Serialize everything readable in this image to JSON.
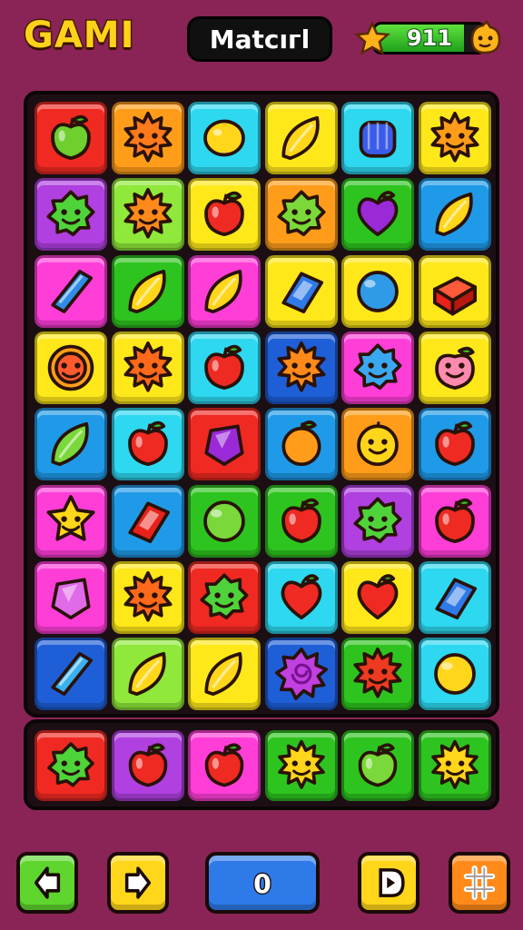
{
  "header": {
    "logo_text": "GAMI",
    "title": "Matcıгl",
    "score": "911",
    "score_fill": 0.82
  },
  "colors": {
    "red": "#f02a22",
    "orange": "#ff9d1a",
    "yellow": "#ffe81a",
    "lime": "#8fe83a",
    "green": "#2ec41f",
    "cyan": "#2ed8f0",
    "blue": "#1f9ae8",
    "navy": "#1e5fd8",
    "purple": "#b040e0",
    "magenta": "#ff3ed8",
    "background": "#8a2457"
  },
  "board": {
    "rows": [
      [
        {
          "bg": "red",
          "icon": "apple-icon",
          "fill": "#6ecf2e"
        },
        {
          "bg": "orange",
          "icon": "sun-face-icon",
          "fill": "#ff7a1a"
        },
        {
          "bg": "cyan",
          "icon": "lemon-icon",
          "fill": "#ffd61a"
        },
        {
          "bg": "yellow",
          "icon": "leaf-icon",
          "fill": "#ffd61a"
        },
        {
          "bg": "cyan",
          "icon": "jar-icon",
          "fill": "#3a5ce8"
        },
        {
          "bg": "yellow",
          "icon": "sun-face-icon",
          "fill": "#ff9d1a"
        }
      ],
      [
        {
          "bg": "purple",
          "icon": "blob-face-icon",
          "fill": "#4fd33a"
        },
        {
          "bg": "lime",
          "icon": "sun-face-icon",
          "fill": "#ff8a1a"
        },
        {
          "bg": "yellow",
          "icon": "apple-icon",
          "fill": "#ee2a22"
        },
        {
          "bg": "orange",
          "icon": "blob-face-icon",
          "fill": "#7ad83a"
        },
        {
          "bg": "green",
          "icon": "heart-fruit-icon",
          "fill": "#9a2ad8"
        },
        {
          "bg": "blue",
          "icon": "leaf-icon",
          "fill": "#ffd61a"
        }
      ],
      [
        {
          "bg": "magenta",
          "icon": "crystal-icon",
          "fill": "#2e8ce8"
        },
        {
          "bg": "green",
          "icon": "leaf-icon",
          "fill": "#ffd61a"
        },
        {
          "bg": "magenta",
          "icon": "leaf-icon",
          "fill": "#ffd61a"
        },
        {
          "bg": "yellow",
          "icon": "candy-box-icon",
          "fill": "#2e7ae8"
        },
        {
          "bg": "yellow",
          "icon": "ball-icon",
          "fill": "#2e9ae8"
        },
        {
          "bg": "yellow",
          "icon": "gift-box-icon",
          "fill": "#e8221a"
        }
      ],
      [
        {
          "bg": "yellow",
          "icon": "lion-face-icon",
          "fill": "#ff5a2e"
        },
        {
          "bg": "yellow",
          "icon": "sun-face-icon",
          "fill": "#ff6a1a"
        },
        {
          "bg": "cyan",
          "icon": "apple-icon",
          "fill": "#ee2a22"
        },
        {
          "bg": "navy",
          "icon": "sun-face-icon",
          "fill": "#ff8a1a"
        },
        {
          "bg": "magenta",
          "icon": "blob-face-icon",
          "fill": "#3aa8f0"
        },
        {
          "bg": "yellow",
          "icon": "peach-face-icon",
          "fill": "#ff8ab0"
        }
      ],
      [
        {
          "bg": "blue",
          "icon": "leaf-icon",
          "fill": "#7ad83a"
        },
        {
          "bg": "cyan",
          "icon": "apple-icon",
          "fill": "#ee2a22"
        },
        {
          "bg": "red",
          "icon": "gem-icon",
          "fill": "#9a2ad8"
        },
        {
          "bg": "blue",
          "icon": "orange-icon",
          "fill": "#ff9d1a"
        },
        {
          "bg": "orange",
          "icon": "smile-face-icon",
          "fill": "#ffd61a"
        },
        {
          "bg": "blue",
          "icon": "apple-icon",
          "fill": "#ee2a22"
        }
      ],
      [
        {
          "bg": "magenta",
          "icon": "star-face-icon",
          "fill": "#ffd61a"
        },
        {
          "bg": "blue",
          "icon": "candy-box-icon",
          "fill": "#e8221a"
        },
        {
          "bg": "green",
          "icon": "ball-icon",
          "fill": "#7ad83a"
        },
        {
          "bg": "green",
          "icon": "apple-icon",
          "fill": "#ee2a22"
        },
        {
          "bg": "purple",
          "icon": "blob-face-icon",
          "fill": "#4fd33a"
        },
        {
          "bg": "magenta",
          "icon": "apple-icon",
          "fill": "#ee2a22"
        }
      ],
      [
        {
          "bg": "magenta",
          "icon": "gem-icon",
          "fill": "#e06ae8"
        },
        {
          "bg": "yellow",
          "icon": "sun-face-icon",
          "fill": "#ff6a1a"
        },
        {
          "bg": "red",
          "icon": "blob-face-icon",
          "fill": "#4fd33a"
        },
        {
          "bg": "cyan",
          "icon": "heart-fruit-icon",
          "fill": "#ee2a22"
        },
        {
          "bg": "yellow",
          "icon": "heart-fruit-icon",
          "fill": "#ee2a22"
        },
        {
          "bg": "cyan",
          "icon": "candy-box-icon",
          "fill": "#2e7ae8"
        }
      ],
      [
        {
          "bg": "navy",
          "icon": "crystal-icon",
          "fill": "#3ab0f0"
        },
        {
          "bg": "lime",
          "icon": "leaf-icon",
          "fill": "#ffd61a"
        },
        {
          "bg": "yellow",
          "icon": "leaf-icon",
          "fill": "#ffd61a"
        },
        {
          "bg": "navy",
          "icon": "swirl-flower-icon",
          "fill": "#c040e0"
        },
        {
          "bg": "green",
          "icon": "sun-face-icon",
          "fill": "#ee3a22"
        },
        {
          "bg": "cyan",
          "icon": "ball-icon",
          "fill": "#ffd61a"
        }
      ]
    ]
  },
  "tray": {
    "items": [
      {
        "bg": "red",
        "icon": "blob-face-icon",
        "fill": "#4fd33a"
      },
      {
        "bg": "purple",
        "icon": "apple-icon",
        "fill": "#ee2a22"
      },
      {
        "bg": "magenta",
        "icon": "apple-icon",
        "fill": "#ee2a22"
      },
      {
        "bg": "green",
        "icon": "sun-face-icon",
        "fill": "#ffd61a"
      },
      {
        "bg": "green",
        "icon": "apple-icon",
        "fill": "#7ad83a"
      },
      {
        "bg": "green",
        "icon": "sun-face-icon",
        "fill": "#ffd61a"
      }
    ]
  },
  "controls": [
    {
      "name": "back-button",
      "icon": "arrow-left-icon",
      "color": "#5ed62e"
    },
    {
      "name": "forward-button",
      "icon": "arrow-right-icon",
      "color": "#ffd61a"
    },
    {
      "name": "center-button",
      "icon": "circle-o-icon",
      "color": "#2e7ae8",
      "label": "0"
    },
    {
      "name": "play-button",
      "icon": "play-d-icon",
      "color": "#ffd61a"
    },
    {
      "name": "menu-button",
      "icon": "grid-hash-icon",
      "color": "#ff8a1a"
    }
  ]
}
